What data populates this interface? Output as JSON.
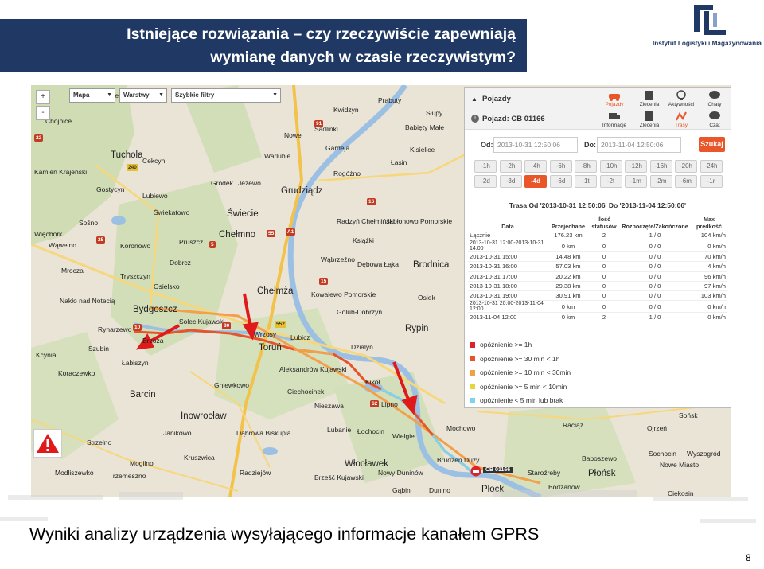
{
  "slide": {
    "title_line1": "Istniejące rozwiązania – czy rzeczywiście zapewniają",
    "title_line2": "wymianę danych w czasie rzeczywistym?",
    "caption": "Wyniki analizy urządzenia wysyłającego informacje kanałem GPRS",
    "page_number": "8",
    "logo_text": "Instytut Logistyki i Magazynowania",
    "title_bg": "#203864"
  },
  "map": {
    "controls": {
      "map_type": "Mapa",
      "layers": "Warstwy",
      "quick_filters": "Szybkie filtry"
    },
    "zoom": [
      "+",
      "-"
    ],
    "vehicle_marker": "CB 01166",
    "cities": [
      {
        "name": "Chojnice"
      },
      {
        "name": "Czersk"
      },
      {
        "name": "Kwidzyn"
      },
      {
        "name": "Prabuty"
      },
      {
        "name": "Sadlinki"
      },
      {
        "name": "Babięty Małe"
      },
      {
        "name": "Słupy"
      },
      {
        "name": "Nowe"
      },
      {
        "name": "Kisielice"
      },
      {
        "name": "Tuchola"
      },
      {
        "name": "Cekcyn"
      },
      {
        "name": "Warlubie"
      },
      {
        "name": "Gardeja"
      },
      {
        "name": "Łasin"
      },
      {
        "name": "Kamień Krajeński"
      },
      {
        "name": "Gostycyn"
      },
      {
        "name": "Lubiewo"
      },
      {
        "name": "Jeżewo"
      },
      {
        "name": "Gródek"
      },
      {
        "name": "Rogóżno"
      },
      {
        "name": "Grudziądz"
      },
      {
        "name": "Radzyń Chełmiński"
      },
      {
        "name": "Jabłonowo Pomorskie"
      },
      {
        "name": "Świekatowo"
      },
      {
        "name": "Świecie"
      },
      {
        "name": "Sośno"
      },
      {
        "name": "Więcbork"
      },
      {
        "name": "Chełmno"
      },
      {
        "name": "Książki"
      },
      {
        "name": "Koronowo"
      },
      {
        "name": "Pruszcz"
      },
      {
        "name": "Dobrcz"
      },
      {
        "name": "Wąbrzeźno"
      },
      {
        "name": "Dębowa Łąka"
      },
      {
        "name": "Brodnica"
      },
      {
        "name": "Wąwelno"
      },
      {
        "name": "Mrocza"
      },
      {
        "name": "Tryszczyn"
      },
      {
        "name": "Osielsko"
      },
      {
        "name": "Chełmża"
      },
      {
        "name": "Nakło nad Notecią"
      },
      {
        "name": "Bydgoszcz"
      },
      {
        "name": "Solec Kujawski"
      },
      {
        "name": "Wrzosy"
      },
      {
        "name": "Toruń"
      },
      {
        "name": "Lubicz"
      },
      {
        "name": "Kowalewo Pomorskie"
      },
      {
        "name": "Golub-Dobrzyń"
      },
      {
        "name": "Rynarzewo"
      },
      {
        "name": "Brzoza"
      },
      {
        "name": "Osiek"
      },
      {
        "name": "Rypin"
      },
      {
        "name": "Szubin"
      },
      {
        "name": "Łabiszyn"
      },
      {
        "name": "Dzialyń"
      },
      {
        "name": "Kcynia"
      },
      {
        "name": "Ciechocinek"
      },
      {
        "name": "Aleksandrów Kujawski"
      },
      {
        "name": "Kikół"
      },
      {
        "name": "Lipno"
      },
      {
        "name": "Koraczewko"
      },
      {
        "name": "Gniewkowo"
      },
      {
        "name": "Nieszawa"
      },
      {
        "name": "Barcin"
      },
      {
        "name": "Inowrocław"
      },
      {
        "name": "Łochocin"
      },
      {
        "name": "Lubanie"
      },
      {
        "name": "Wielgie"
      },
      {
        "name": "Mochowo"
      },
      {
        "name": "Raciąż"
      },
      {
        "name": "Ojrzeń"
      },
      {
        "name": "Sońsk"
      },
      {
        "name": "Janikowo"
      },
      {
        "name": "Dąbrowa Biskupia"
      },
      {
        "name": "Strzelno"
      },
      {
        "name": "Brudzeń Duży"
      },
      {
        "name": "Baboszewo"
      },
      {
        "name": "Sochocin"
      },
      {
        "name": "Wyszogród"
      },
      {
        "name": "Kruszwica"
      },
      {
        "name": "Włocławek"
      },
      {
        "name": "Płock"
      },
      {
        "name": "Płońsk"
      },
      {
        "name": "Nowe Miasto"
      },
      {
        "name": "Mogilno"
      },
      {
        "name": "Modliszewko"
      },
      {
        "name": "Trzemeszno"
      },
      {
        "name": "Radziejów"
      },
      {
        "name": "Brześć Kujawski"
      },
      {
        "name": "Dunino"
      },
      {
        "name": "Staroźreby"
      },
      {
        "name": "Ciekosin"
      },
      {
        "name": "Nowy Duninów"
      },
      {
        "name": "Gąbin"
      },
      {
        "name": "Bodzanów"
      }
    ],
    "roads": [
      "240",
      "22",
      "55",
      "91",
      "A1",
      "16",
      "5",
      "10",
      "25",
      "15",
      "80",
      "552",
      "62",
      "V",
      "V"
    ]
  },
  "panel": {
    "section_title": "Pojazdy",
    "vehicle_label": "Pojazd: CB 01166",
    "toolbar": [
      {
        "label": "Pojazdy",
        "icon": "car-icon",
        "active": true
      },
      {
        "label": "Zlecenia",
        "icon": "document-icon",
        "active": false
      },
      {
        "label": "Aktywności",
        "icon": "lightbulb-icon",
        "active": false
      },
      {
        "label": "Chaty",
        "icon": "chat-icon",
        "active": false
      },
      {
        "label": "Informacje",
        "icon": "truck-icon",
        "active": false
      },
      {
        "label": "Zlecenia",
        "icon": "document-icon",
        "active": false
      },
      {
        "label": "Trasy",
        "icon": "route-icon",
        "active": true
      },
      {
        "label": "Czat",
        "icon": "chat-icon",
        "active": false
      }
    ],
    "od_label": "Od:",
    "od_value": "2013-10-31 12:50:06",
    "do_label": "Do:",
    "do_value": "2013-11-04 12:50:06",
    "search_button": "Szukaj",
    "quick_past": [
      "-1h",
      "-2h",
      "-4h",
      "-6h",
      "-8h",
      "-10h",
      "-12h",
      "-16h",
      "-20h",
      "-24h"
    ],
    "quick_days": [
      "-2d",
      "-3d",
      "-4d",
      "-6d",
      "-1t",
      "-2t",
      "-1m",
      "-2m",
      "-6m",
      "-1r"
    ],
    "active_quick": "-4d",
    "trasa_title": "Trasa Od '2013-10-31 12:50:06' Do '2013-11-04 12:50:06'",
    "table": {
      "headers": [
        "Data",
        "Przejechane",
        "Ilość statusów",
        "Rozpoczęte/Zakończone",
        "Max prędkość"
      ],
      "rows": [
        [
          "Łącznie",
          "176.23 km",
          "2",
          "1 / 0",
          "104 km/h"
        ],
        [
          "2013-10-31 12:00-2013-10-31 14:00",
          "0 km",
          "0",
          "0 / 0",
          "0 km/h"
        ],
        [
          "2013-10-31 15:00",
          "14.48 km",
          "0",
          "0 / 0",
          "70 km/h"
        ],
        [
          "2013-10-31 16:00",
          "57.03 km",
          "0",
          "0 / 0",
          "4 km/h"
        ],
        [
          "2013-10-31 17:00",
          "20.22 km",
          "0",
          "0 / 0",
          "96 km/h"
        ],
        [
          "2013-10-31 18:00",
          "29.38 km",
          "0",
          "0 / 0",
          "97 km/h"
        ],
        [
          "2013-10-31 19:00",
          "30.91 km",
          "0",
          "0 / 0",
          "103 km/h"
        ],
        [
          "2013-10-31 20:00-2013-11-04 12:00",
          "0 km",
          "0",
          "0 / 0",
          "0 km/h"
        ],
        [
          "2013-11-04 12:00",
          "0 km",
          "2",
          "1 / 0",
          "0 km/h"
        ]
      ]
    },
    "legend": [
      {
        "label": "opóźnienie >= 1h",
        "color": "#d9242b"
      },
      {
        "label": "opóźnienie >= 30 min < 1h",
        "color": "#e8542a"
      },
      {
        "label": "opóźnienie >= 10 min < 30min",
        "color": "#f0a04a"
      },
      {
        "label": "opóźnienie >= 5 min < 10min",
        "color": "#e3d83a"
      },
      {
        "label": "opóźnienie < 5 min lub brak",
        "color": "#7fd3ea"
      }
    ]
  }
}
